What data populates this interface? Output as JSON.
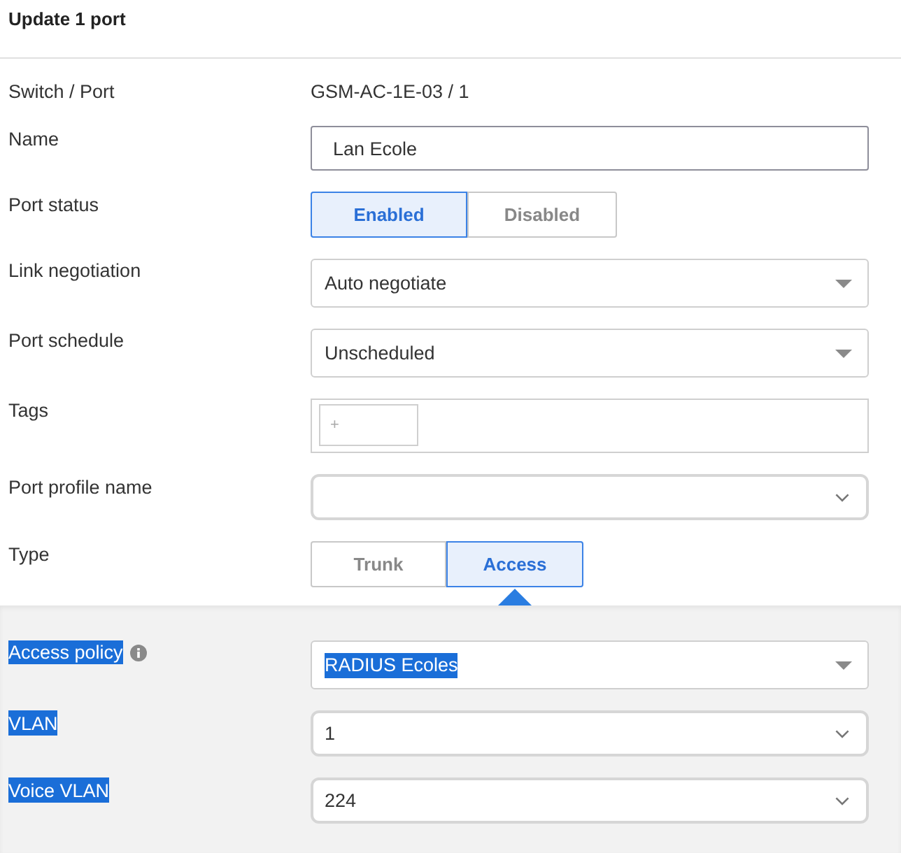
{
  "header": {
    "title": "Update 1 port"
  },
  "fields": [
    {
      "kind": "static",
      "label": "Switch / Port",
      "value": "GSM-AC-1E-03 / 1"
    },
    {
      "kind": "input",
      "label": "Name",
      "value": "Lan Ecole"
    },
    {
      "kind": "segmented",
      "label": "Port status",
      "pointer": false,
      "options": [
        {
          "label": "Enabled",
          "selected": true
        },
        {
          "label": "Disabled",
          "selected": false
        }
      ]
    },
    {
      "kind": "select",
      "label": "Link negotiation",
      "value": "Auto negotiate"
    },
    {
      "kind": "select",
      "label": "Port schedule",
      "value": "Unscheduled"
    },
    {
      "kind": "tags",
      "label": "Tags",
      "add_label": "+"
    },
    {
      "kind": "combobox",
      "label": "Port profile name"
    },
    {
      "kind": "segmented",
      "label": "Type",
      "pointer": true,
      "options": [
        {
          "label": "Trunk",
          "selected": false
        },
        {
          "label": "Access",
          "selected": true
        }
      ]
    }
  ],
  "access_section": {
    "fields": [
      {
        "kind": "select",
        "label": "Access policy",
        "label_highlighted": true,
        "info": true,
        "value": "RADIUS Ecoles",
        "value_highlighted": true
      },
      {
        "kind": "combobox",
        "label": "VLAN",
        "label_highlighted": true,
        "info": false,
        "value": "1",
        "value_highlighted": false
      },
      {
        "kind": "combobox",
        "label": "Voice VLAN",
        "label_highlighted": true,
        "info": false,
        "value": "224",
        "value_highlighted": false
      }
    ]
  }
}
